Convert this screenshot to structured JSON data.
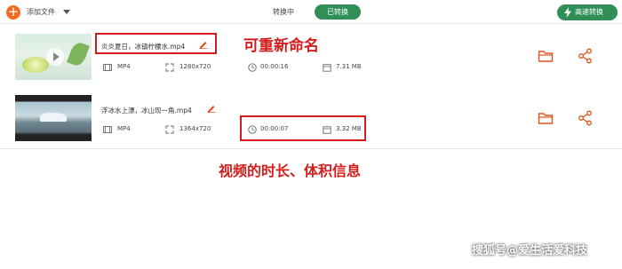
{
  "topbar": {
    "add_file_label": "添加文件",
    "tab_converting": "转换中",
    "tab_converted": "已转换",
    "high_speed_label": "高速转换",
    "accent_color": "#f26b21",
    "green_color": "#2f8f57"
  },
  "files": [
    {
      "name": "炎炎夏日，冰镇柠檬水.mp4",
      "format": "MP4",
      "resolution": "1280x720",
      "duration": "00:00:16",
      "size": "7.31 MB"
    },
    {
      "name": "浮冰水上漂，冰山现一角.mp4",
      "format": "MP4",
      "resolution": "1364x720",
      "duration": "00:00:07",
      "size": "3.32 MB"
    }
  ],
  "annotations": {
    "rename_note": "可重新命名",
    "info_note": "视频的时长、体积信息",
    "color": "#d51c1c"
  },
  "watermark": "搜狐号@爱生活爱科技",
  "icons": [
    "plus-icon",
    "caret-down-icon",
    "lightning-icon",
    "edit-pencil-icon",
    "film-icon",
    "resize-icon",
    "clock-icon",
    "calendar-icon",
    "folder-icon",
    "share-icon",
    "play-icon"
  ]
}
